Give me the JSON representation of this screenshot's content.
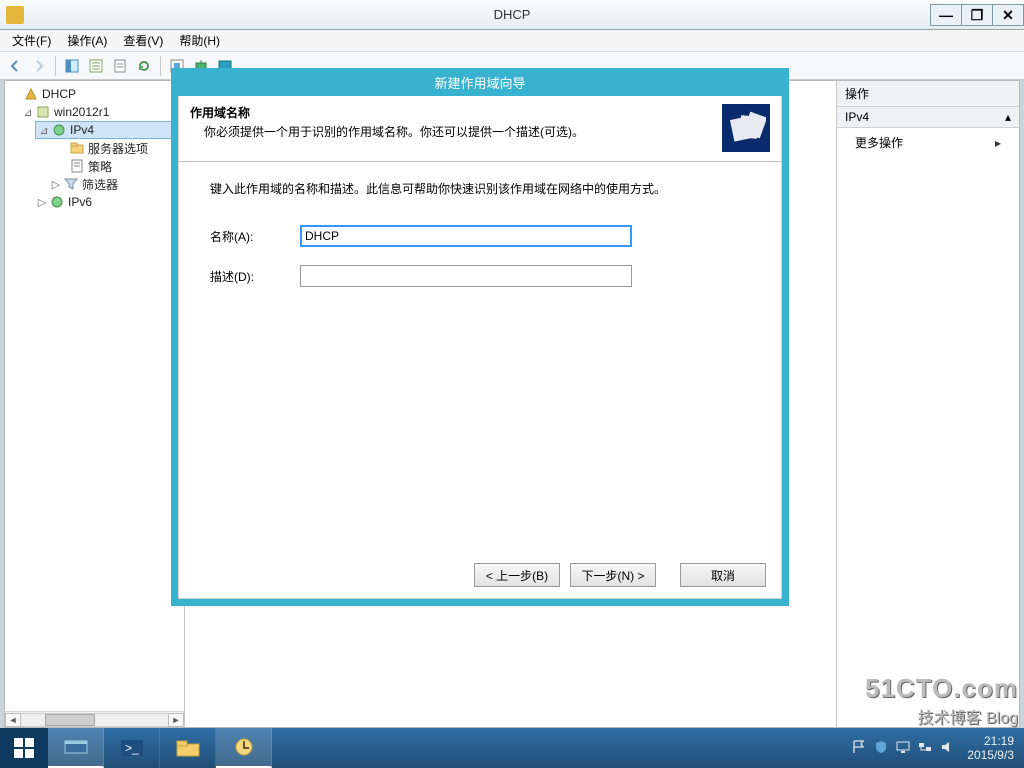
{
  "window": {
    "title": "DHCP"
  },
  "menu": {
    "file": "文件(F)",
    "action": "操作(A)",
    "view": "查看(V)",
    "help": "帮助(H)"
  },
  "tree": {
    "root": "DHCP",
    "server": "win2012r1",
    "ipv4": "IPv4",
    "srvopts": "服务器选项",
    "policy": "策略",
    "filter": "筛选器",
    "ipv6": "IPv6"
  },
  "actions": {
    "header": "操作",
    "section": "IPv4",
    "more": "更多操作"
  },
  "wizard": {
    "title": "新建作用域向导",
    "heading": "作用域名称",
    "subheading": "你必须提供一个用于识别的作用域名称。你还可以提供一个描述(可选)。",
    "instruction": "键入此作用域的名称和描述。此信息可帮助你快速识别该作用域在网络中的使用方式。",
    "name_label": "名称(A):",
    "name_value": "DHCP",
    "desc_label": "描述(D):",
    "desc_value": "",
    "back": "< 上一步(B)",
    "next": "下一步(N) >",
    "cancel": "取消"
  },
  "taskbar": {
    "time": "21:19",
    "date": "2015/9/3"
  },
  "watermark": {
    "line1": "51CTO.com",
    "line2": "技术博客 Blog"
  }
}
